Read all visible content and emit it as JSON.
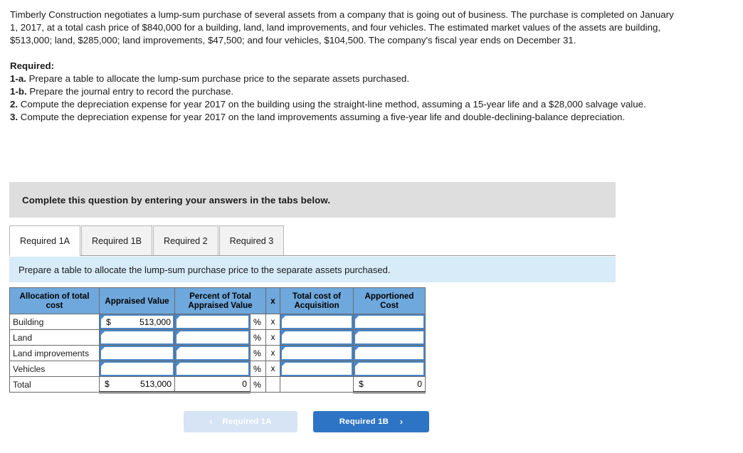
{
  "problem": {
    "paragraph": "Timberly Construction negotiates a lump-sum purchase of several assets from a company that is going out of business. The purchase is completed on January 1, 2017, at a total cash price of $840,000 for a building, land, land improvements, and four vehicles. The estimated market values of the assets are building, $513,000; land, $285,000; land improvements, $47,500; and four vehicles, $104,500. The company's fiscal year ends on December 31."
  },
  "required": {
    "heading": "Required:",
    "items": [
      {
        "num": "1-a.",
        "text": " Prepare a table to allocate the lump-sum purchase price to the separate assets purchased."
      },
      {
        "num": "1-b.",
        "text": " Prepare the journal entry to record the purchase."
      },
      {
        "num": "2.",
        "text": " Compute the depreciation expense for year 2017 on the building using the straight-line method, assuming a 15-year life and a $28,000 salvage value."
      },
      {
        "num": "3.",
        "text": " Compute the depreciation expense for year 2017 on the land improvements assuming a five-year life and double-declining-balance depreciation."
      }
    ]
  },
  "banner": {
    "text": "Complete this question by entering your answers in the tabs below."
  },
  "tabs": [
    {
      "label": "Required 1A",
      "active": true
    },
    {
      "label": "Required 1B",
      "active": false
    },
    {
      "label": "Required 2",
      "active": false
    },
    {
      "label": "Required 3",
      "active": false
    }
  ],
  "instruction": {
    "text": "Prepare a table to allocate the lump-sum purchase price to the separate assets purchased."
  },
  "table": {
    "headers": [
      "Allocation of total cost",
      "Appraised Value",
      "Percent of Total Appraised Value",
      "x",
      "Total cost of Acquisition",
      "Apportioned Cost"
    ],
    "percent_symbol": "%",
    "multiply_symbol": "x",
    "dollar_symbol": "$",
    "rows": [
      {
        "label": "Building",
        "appraised_dollar": "$",
        "appraised_value": "513,000",
        "percent_value": "",
        "total_cost_value": "",
        "apportioned_value": ""
      },
      {
        "label": "Land",
        "appraised_dollar": "",
        "appraised_value": "",
        "percent_value": "",
        "total_cost_value": "",
        "apportioned_value": ""
      },
      {
        "label": "Land improvements",
        "appraised_dollar": "",
        "appraised_value": "",
        "percent_value": "",
        "total_cost_value": "",
        "apportioned_value": ""
      },
      {
        "label": "Vehicles",
        "appraised_dollar": "",
        "appraised_value": "",
        "percent_value": "",
        "total_cost_value": "",
        "apportioned_value": ""
      }
    ],
    "total_row": {
      "label": "Total",
      "appraised_dollar": "$",
      "appraised_value": "513,000",
      "percent_value": "0",
      "total_cost_value": "",
      "apportioned_dollar": "$",
      "apportioned_value": "0"
    }
  },
  "nav": {
    "prev_label": "Required 1A",
    "prev_chevron": "‹",
    "next_label": "Required 1B",
    "next_chevron": "›"
  },
  "colors": {
    "table_header": "#6fa8dc",
    "banner_gray": "#dedede",
    "strip_blue": "#d7ebf9",
    "button_blue": "#2e74c4",
    "button_disabled": "#d6e4f5",
    "input_border": "#4a86c8"
  }
}
